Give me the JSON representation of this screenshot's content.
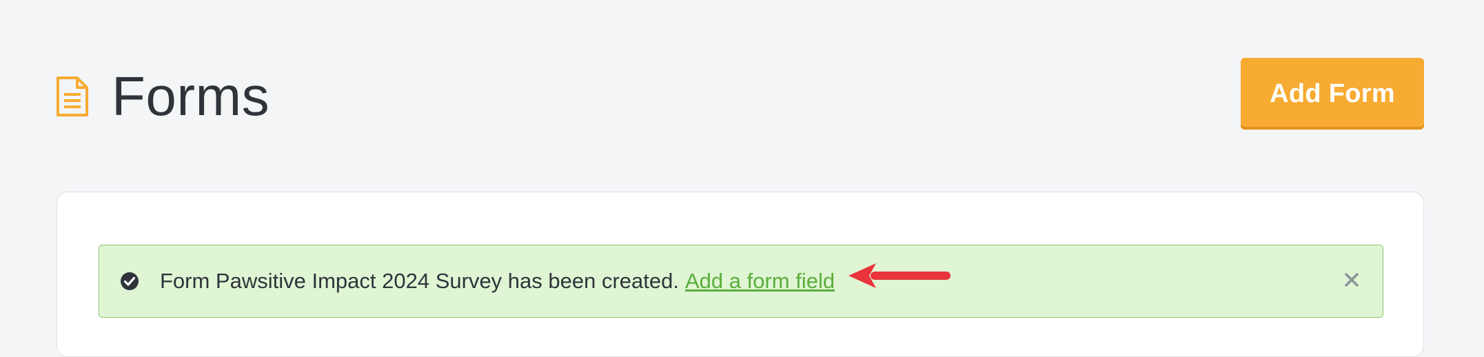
{
  "header": {
    "title": "Forms",
    "icon": "document-icon",
    "add_button_label": "Add Form"
  },
  "alert": {
    "message": "Form Pawsitive Impact 2024 Survey has been created.",
    "link_label": "Add a form field",
    "status_icon": "check-circle-icon",
    "dismiss_icon": "close-icon",
    "annotation_icon": "arrow-icon"
  },
  "colors": {
    "accent": "#f7ab33",
    "title": "#2f343a",
    "success_bg": "#dff5d4",
    "success_border": "#8cc872",
    "success_link": "#5aae3a",
    "annotation_arrow": "#e8343a",
    "page_bg": "#f4f5f7"
  }
}
